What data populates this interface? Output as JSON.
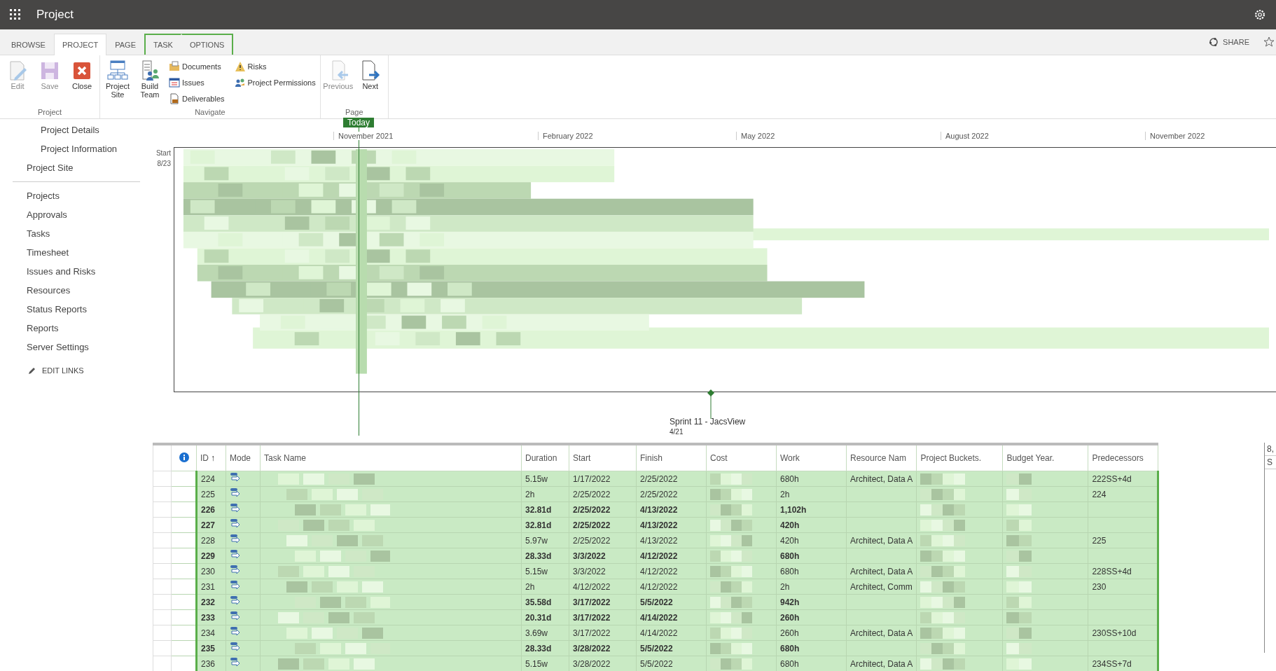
{
  "top_bar": {
    "title": "Project"
  },
  "ribbon": {
    "tabs": [
      {
        "label": "BROWSE",
        "selected": false,
        "kind": "plain"
      },
      {
        "label": "PROJECT",
        "selected": true,
        "kind": "plain"
      },
      {
        "label": "PAGE",
        "selected": false,
        "kind": "plain"
      },
      {
        "label": "TASK",
        "selected": false,
        "kind": "context"
      },
      {
        "label": "OPTIONS",
        "selected": false,
        "kind": "context"
      }
    ],
    "share": "SHARE",
    "groups": [
      {
        "name": "Project",
        "large": [
          {
            "label": "Edit",
            "disabled": true
          },
          {
            "label": "Save",
            "disabled": true
          },
          {
            "label": "Close",
            "disabled": false
          }
        ]
      },
      {
        "name": "Navigate",
        "large": [
          {
            "label": "Project Site",
            "disabled": false
          },
          {
            "label": "Build Team",
            "disabled": false
          }
        ],
        "small": [
          {
            "label": "Documents"
          },
          {
            "label": "Issues"
          },
          {
            "label": "Deliverables"
          },
          {
            "label": "Risks"
          },
          {
            "label": "Project Permissions"
          }
        ]
      },
      {
        "name": "Page",
        "large": [
          {
            "label": "Previous",
            "disabled": true
          },
          {
            "label": "Next",
            "disabled": false
          }
        ]
      }
    ]
  },
  "quick_launch": {
    "items": [
      {
        "label": "Project Details",
        "kind": "sub"
      },
      {
        "label": "Project Information",
        "kind": "sub"
      },
      {
        "label": "Project Site",
        "kind": "top"
      },
      {
        "kind": "divider"
      },
      {
        "label": "Projects",
        "kind": "top"
      },
      {
        "label": "Approvals",
        "kind": "top"
      },
      {
        "label": "Tasks",
        "kind": "top"
      },
      {
        "label": "Timesheet",
        "kind": "top"
      },
      {
        "label": "Issues and Risks",
        "kind": "top"
      },
      {
        "label": "Resources",
        "kind": "top"
      },
      {
        "label": "Status Reports",
        "kind": "top"
      },
      {
        "label": "Reports",
        "kind": "top"
      },
      {
        "label": "Server Settings",
        "kind": "top"
      }
    ],
    "edit_links": "EDIT LINKS"
  },
  "timeline": {
    "today": "Today",
    "start_label": "Start",
    "start_date": "8/23",
    "months": [
      "November 2021",
      "February 2022",
      "May 2022",
      "August 2022",
      "November 2022"
    ],
    "milestone": {
      "name": "Sprint 11 - JacsView",
      "date": "4/21"
    }
  },
  "table": {
    "columns": [
      "ID",
      "Mode",
      "Task Name",
      "Duration",
      "Start",
      "Finish",
      "Cost",
      "Work",
      "Resource Nam",
      "Project Buckets.",
      "Budget Year.",
      "Predecessors"
    ],
    "sort_indicator": "↑",
    "rows": [
      {
        "id": "224",
        "summary": false,
        "duration": "5.15w",
        "start": "1/17/2022",
        "finish": "2/25/2022",
        "work": "680h",
        "resources": "Architect, Data A",
        "predecessors": "222SS+4d"
      },
      {
        "id": "225",
        "summary": false,
        "duration": "2h",
        "start": "2/25/2022",
        "finish": "2/25/2022",
        "work": "2h",
        "resources": "",
        "predecessors": "224"
      },
      {
        "id": "226",
        "summary": true,
        "duration": "32.81d",
        "start": "2/25/2022",
        "finish": "4/13/2022",
        "work": "1,102h",
        "resources": "",
        "predecessors": ""
      },
      {
        "id": "227",
        "summary": true,
        "duration": "32.81d",
        "start": "2/25/2022",
        "finish": "4/13/2022",
        "work": "420h",
        "resources": "",
        "predecessors": ""
      },
      {
        "id": "228",
        "summary": false,
        "duration": "5.97w",
        "start": "2/25/2022",
        "finish": "4/13/2022",
        "work": "420h",
        "resources": "Architect, Data A",
        "predecessors": "225"
      },
      {
        "id": "229",
        "summary": true,
        "duration": "28.33d",
        "start": "3/3/2022",
        "finish": "4/12/2022",
        "work": "680h",
        "resources": "",
        "predecessors": ""
      },
      {
        "id": "230",
        "summary": false,
        "duration": "5.15w",
        "start": "3/3/2022",
        "finish": "4/12/2022",
        "work": "680h",
        "resources": "Architect, Data A",
        "predecessors": "228SS+4d"
      },
      {
        "id": "231",
        "summary": false,
        "duration": "2h",
        "start": "4/12/2022",
        "finish": "4/12/2022",
        "work": "2h",
        "resources": "Architect, Comm",
        "predecessors": "230"
      },
      {
        "id": "232",
        "summary": true,
        "duration": "35.58d",
        "start": "3/17/2022",
        "finish": "5/5/2022",
        "work": "942h",
        "resources": "",
        "predecessors": ""
      },
      {
        "id": "233",
        "summary": true,
        "duration": "20.31d",
        "start": "3/17/2022",
        "finish": "4/14/2022",
        "work": "260h",
        "resources": "",
        "predecessors": ""
      },
      {
        "id": "234",
        "summary": false,
        "duration": "3.69w",
        "start": "3/17/2022",
        "finish": "4/14/2022",
        "work": "260h",
        "resources": "Architect, Data A",
        "predecessors": "230SS+10d"
      },
      {
        "id": "235",
        "summary": true,
        "duration": "28.33d",
        "start": "3/28/2022",
        "finish": "5/5/2022",
        "work": "680h",
        "resources": "",
        "predecessors": ""
      },
      {
        "id": "236",
        "summary": false,
        "duration": "5.15w",
        "start": "3/28/2022",
        "finish": "5/5/2022",
        "work": "680h",
        "resources": "Architect, Data A",
        "predecessors": "234SS+7d"
      }
    ]
  },
  "side_pane": [
    "8,",
    "S"
  ]
}
